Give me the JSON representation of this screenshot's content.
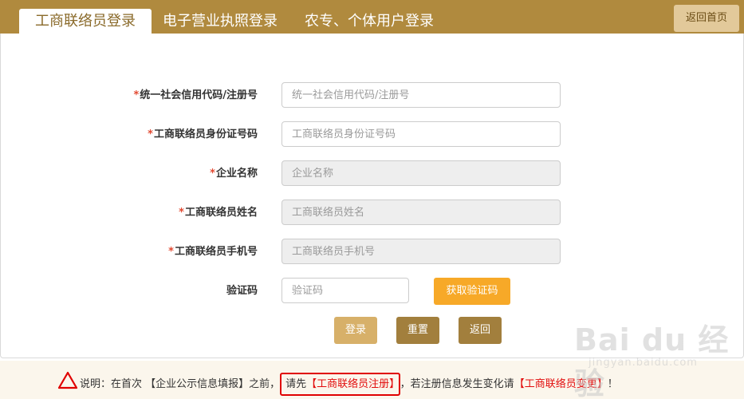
{
  "tabs": [
    {
      "label": "工商联络员登录",
      "active": true
    },
    {
      "label": "电子营业执照登录",
      "active": false
    },
    {
      "label": "农专、个体用户登录",
      "active": false
    }
  ],
  "home_button": "返回首页",
  "form": {
    "required_mark": "*",
    "fields": [
      {
        "label": "统一社会信用代码/注册号",
        "placeholder": "统一社会信用代码/注册号",
        "disabled": false,
        "required": true
      },
      {
        "label": "工商联络员身份证号码",
        "placeholder": "工商联络员身份证号码",
        "disabled": false,
        "required": true
      },
      {
        "label": "企业名称",
        "placeholder": "企业名称",
        "disabled": true,
        "required": true
      },
      {
        "label": "工商联络员姓名",
        "placeholder": "工商联络员姓名",
        "disabled": true,
        "required": true
      },
      {
        "label": "工商联络员手机号",
        "placeholder": "工商联络员手机号",
        "disabled": true,
        "required": true
      }
    ],
    "captcha": {
      "label": "验证码",
      "placeholder": "验证码",
      "button": "获取验证码"
    },
    "buttons": {
      "login": "登录",
      "reset": "重置",
      "back": "返回"
    }
  },
  "notice": {
    "prefix": "说明：在首次 【企业公示信息填报】之前，",
    "register_pre": "请先",
    "register_link": "【工商联络员注册】",
    "middle": "，若注册信息发生变化请",
    "change_link": "【工商联络员变更】",
    "suffix": "！"
  },
  "watermark": {
    "main": "Bai du 经验",
    "sub": "jingyan.baidu.com"
  },
  "colors": {
    "topbar": "#b08a3e",
    "accent_orange": "#f7a928",
    "button_brown": "#a27f3d",
    "button_light": "#d7b069",
    "required_red": "#e24a32",
    "link_red": "#e20d0d"
  }
}
